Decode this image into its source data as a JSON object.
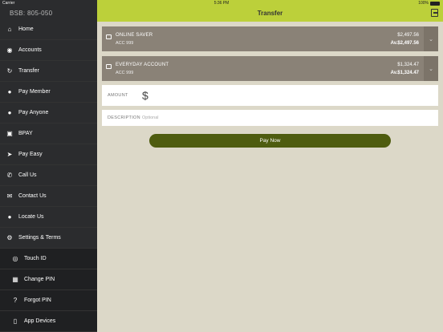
{
  "status_bar": {
    "carrier": "Carrier",
    "time": "5:36 PM",
    "battery": "100%"
  },
  "sidebar": {
    "bsb": "BSB: 805-050",
    "items": [
      {
        "label": "Home",
        "icon": "home-icon"
      },
      {
        "label": "Accounts",
        "icon": "dollar-circle-icon"
      },
      {
        "label": "Transfer",
        "icon": "refresh-icon"
      },
      {
        "label": "Pay Member",
        "icon": "person-icon"
      },
      {
        "label": "Pay Anyone",
        "icon": "people-icon"
      },
      {
        "label": "BPAY",
        "icon": "bpay-icon"
      },
      {
        "label": "Pay Easy",
        "icon": "paper-plane-icon"
      },
      {
        "label": "Call Us",
        "icon": "phone-icon"
      },
      {
        "label": "Contact Us",
        "icon": "envelope-icon"
      },
      {
        "label": "Locate Us",
        "icon": "map-pin-icon"
      },
      {
        "label": "Settings & Terms",
        "icon": "gear-icon"
      }
    ],
    "subitems": [
      {
        "label": "Touch ID",
        "icon": "fingerprint-icon"
      },
      {
        "label": "Change PIN",
        "icon": "keypad-icon"
      },
      {
        "label": "Forgot PIN",
        "icon": "question-icon"
      },
      {
        "label": "App Devices",
        "icon": "tablet-icon"
      }
    ]
  },
  "header": {
    "title": "Transfer"
  },
  "from_account": {
    "name": "ONLINE SAVER",
    "acc": "ACC 999",
    "balance": "$2,497.56",
    "available": "Av.$2,497.56"
  },
  "to_account": {
    "name": "EVERYDAY ACCOUNT",
    "acc": "ACC 999",
    "balance": "$1,324.47",
    "available": "Av.$1,324.47"
  },
  "amount": {
    "label": "AMOUNT",
    "symbol": "$"
  },
  "description": {
    "label": "DESCRIPTION",
    "placeholder": "Optional"
  },
  "pay_button": "Pay Now",
  "colors": {
    "accent": "#bcd03a",
    "sidebar": "#2b2c2e",
    "button": "#4e5c0f",
    "account_card": "#8a8277",
    "background": "#dcd8c8"
  }
}
